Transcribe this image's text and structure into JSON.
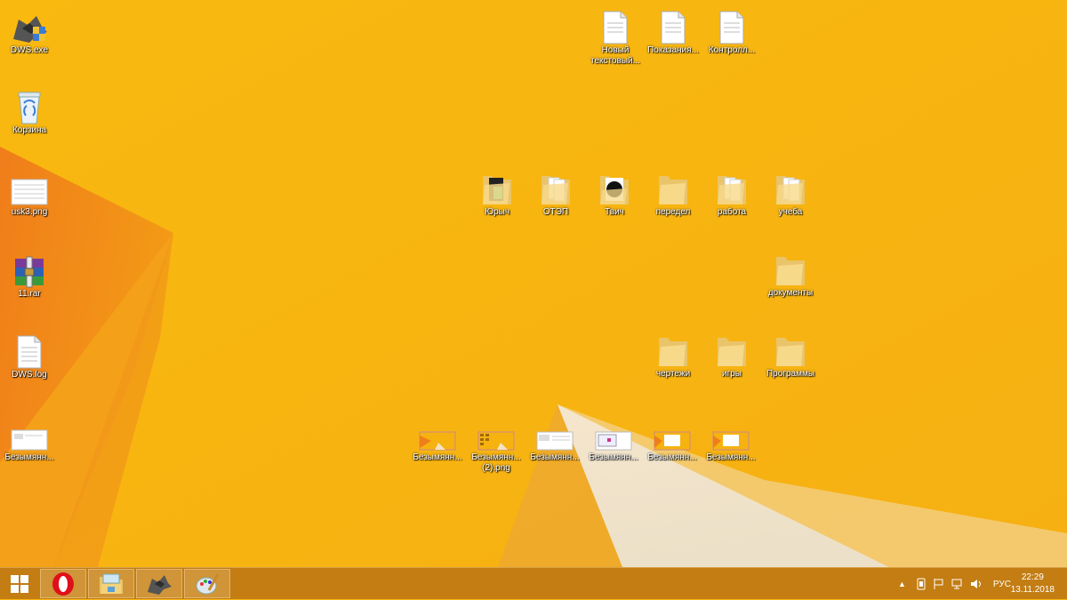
{
  "desktop": {
    "left_icons": [
      {
        "name": "dws-exe-icon",
        "label": "DWS.exe",
        "kind": "exe"
      },
      {
        "name": "recycle-bin-icon",
        "label": "Корзина",
        "kind": "bin"
      },
      {
        "name": "usk3-png-icon",
        "label": "usk3.png",
        "kind": "image-white"
      },
      {
        "name": "11-rar-icon",
        "label": "11.rar",
        "kind": "rar"
      },
      {
        "name": "dws-log-icon",
        "label": "DWS.log",
        "kind": "doc"
      },
      {
        "name": "bezymyann-left-icon",
        "label": "Безымянн...",
        "kind": "image-white"
      }
    ],
    "top_files": [
      {
        "name": "new-text-file-icon",
        "label": "Новый текстовый..."
      },
      {
        "name": "pokazaniya-file-icon",
        "label": "Показания..."
      },
      {
        "name": "kontroll-file-icon",
        "label": "Контролл..."
      }
    ],
    "folder_row": [
      {
        "name": "folder-yurych",
        "label": "Юрыч",
        "variant": "photo"
      },
      {
        "name": "folder-otep",
        "label": "ОТЭП",
        "variant": "docs"
      },
      {
        "name": "folder-tvich",
        "label": "Твич",
        "variant": "dark"
      },
      {
        "name": "folder-peredel",
        "label": "передел",
        "variant": "plain"
      },
      {
        "name": "folder-rabota",
        "label": "работа",
        "variant": "docs"
      },
      {
        "name": "folder-ucheba",
        "label": "учеба",
        "variant": "docs"
      }
    ],
    "folder_dokumenty": {
      "name": "folder-dokumenty",
      "label": "документы"
    },
    "folder_row2": [
      {
        "name": "folder-chertezhi",
        "label": "чертежи",
        "variant": "plain"
      },
      {
        "name": "folder-igry",
        "label": "игры",
        "variant": "plain"
      },
      {
        "name": "folder-programmy",
        "label": "Программы",
        "variant": "plain"
      }
    ],
    "image_row": [
      {
        "name": "image-bezymyann-1",
        "label": "Безымянн...",
        "style": "orange"
      },
      {
        "name": "image-bezymyann-2",
        "label": "Безымянн... (2).png",
        "style": "orange-grid"
      },
      {
        "name": "image-bezymyann-3",
        "label": "Безымянн...",
        "style": "white"
      },
      {
        "name": "image-bezymyann-4",
        "label": "Безымянн...",
        "style": "white-window"
      },
      {
        "name": "image-bezymyann-5",
        "label": "Безымянн...",
        "style": "orange-window"
      },
      {
        "name": "image-bezymyann-6",
        "label": "Безымянн...",
        "style": "orange-window"
      }
    ]
  },
  "taskbar": {
    "apps": [
      {
        "name": "taskbar-opera",
        "icon": "opera-icon"
      },
      {
        "name": "taskbar-explorer",
        "icon": "file-explorer-icon"
      },
      {
        "name": "taskbar-dws",
        "icon": "dws-app-icon"
      },
      {
        "name": "taskbar-paint",
        "icon": "paint-icon"
      }
    ],
    "language": "РУС",
    "time": "22:29",
    "date": "13.11.2018"
  },
  "colors": {
    "wallpaper": "#f7b50e",
    "wallpaper_dark": "#f08a1c",
    "taskbar": "#be7814"
  }
}
